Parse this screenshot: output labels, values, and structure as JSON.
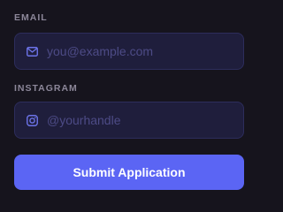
{
  "form": {
    "email": {
      "label": "EMAIL",
      "placeholder": "you@example.com",
      "value": "",
      "icon": "mail-icon"
    },
    "instagram": {
      "label": "INSTAGRAM",
      "placeholder": "@yourhandle",
      "value": "",
      "icon": "instagram-icon"
    },
    "submit_label": "Submit Application"
  },
  "colors": {
    "background": "#16141d",
    "input_background": "#1f1e3c",
    "input_border": "#2d2d5c",
    "icon": "#6c73e8",
    "placeholder": "#4d4b86",
    "label": "#8c8799",
    "accent": "#5b65f4"
  }
}
